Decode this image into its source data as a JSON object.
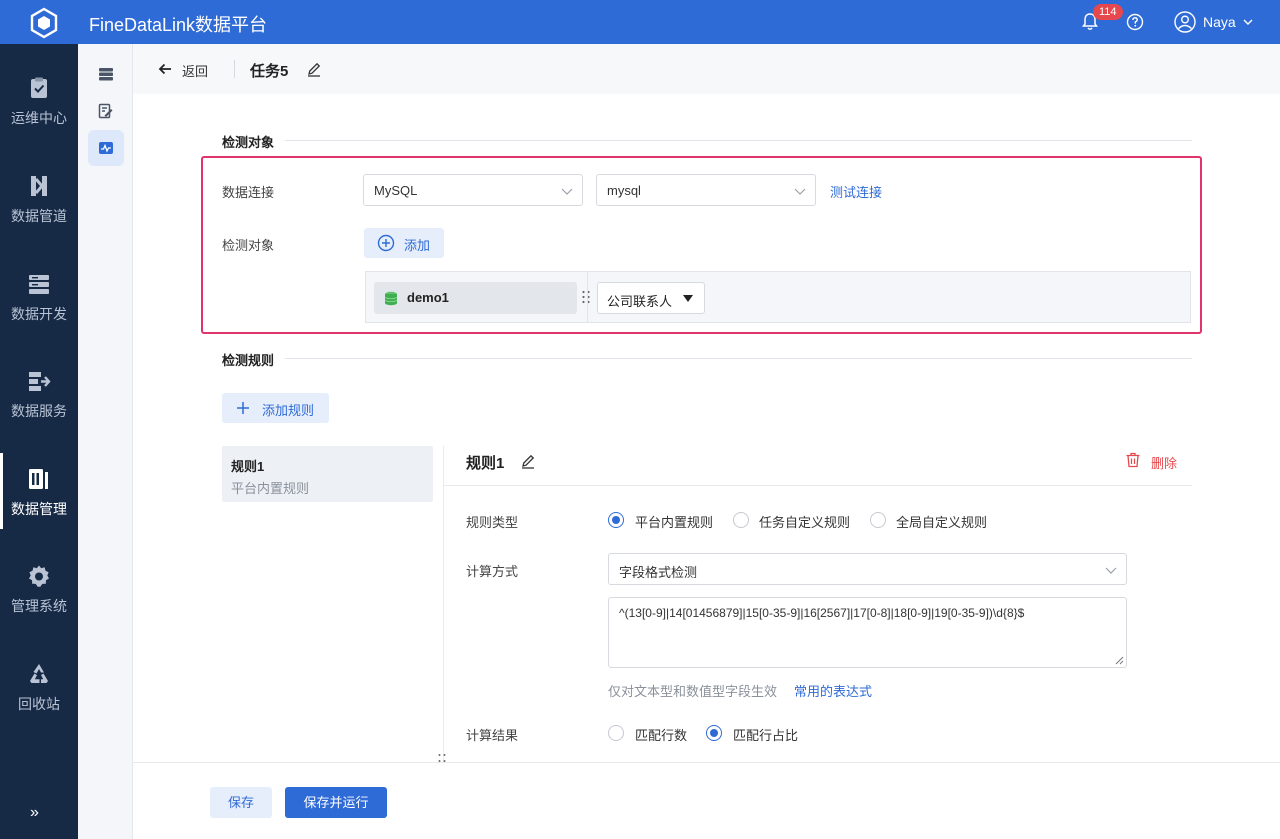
{
  "app": {
    "title": "FineDataLink数据平台"
  },
  "topbar": {
    "notification_count": "114",
    "user_name": "Naya"
  },
  "sidebar": {
    "items": [
      {
        "label": "运维中心",
        "icon": "clipboard-check-icon"
      },
      {
        "label": "数据管道",
        "icon": "pipeline-icon"
      },
      {
        "label": "数据开发",
        "icon": "server-stack-icon"
      },
      {
        "label": "数据服务",
        "icon": "service-icon"
      },
      {
        "label": "数据管理",
        "icon": "data-manage-icon",
        "active": true
      },
      {
        "label": "管理系统",
        "icon": "gear-icon"
      },
      {
        "label": "回收站",
        "icon": "recycle-icon"
      }
    ],
    "collapse_label": "»"
  },
  "header": {
    "back_label": "返回",
    "task_title": "任务5"
  },
  "detect_object": {
    "section_title": "检测对象",
    "connection_label": "数据连接",
    "db_type": "MySQL",
    "db_name": "mysql",
    "test_link": "测试连接",
    "object_label": "检测对象",
    "add_label": "添加",
    "table_name": "demo1",
    "field_name": "公司联系人"
  },
  "detect_rules": {
    "section_title": "检测规则",
    "add_rule_label": "添加规则",
    "rules": [
      {
        "name": "规则1",
        "type": "平台内置规则"
      }
    ],
    "current": {
      "title": "规则1",
      "delete_label": "删除",
      "rule_type_label": "规则类型",
      "rule_type_options": [
        "平台内置规则",
        "任务自定义规则",
        "全局自定义规则"
      ],
      "rule_type_selected": "平台内置规则",
      "calc_method_label": "计算方式",
      "calc_method_value": "字段格式检测",
      "regex": "^(13[0-9]|14[01456879]|15[0-35-9]|16[2567]|17[0-8]|18[0-9]|19[0-35-9])\\d{8}$",
      "hint": "仅对文本型和数值型字段生效",
      "hint_link": "常用的表达式",
      "calc_result_label": "计算结果",
      "calc_result_options": [
        "匹配行数",
        "匹配行占比"
      ],
      "calc_result_selected": "匹配行占比"
    }
  },
  "footer": {
    "save_label": "保存",
    "save_run_label": "保存并运行"
  },
  "colors": {
    "brand": "#2f6bd6",
    "sidebar": "#162a46",
    "highlight": "#e0356b",
    "danger": "#e5484d"
  }
}
